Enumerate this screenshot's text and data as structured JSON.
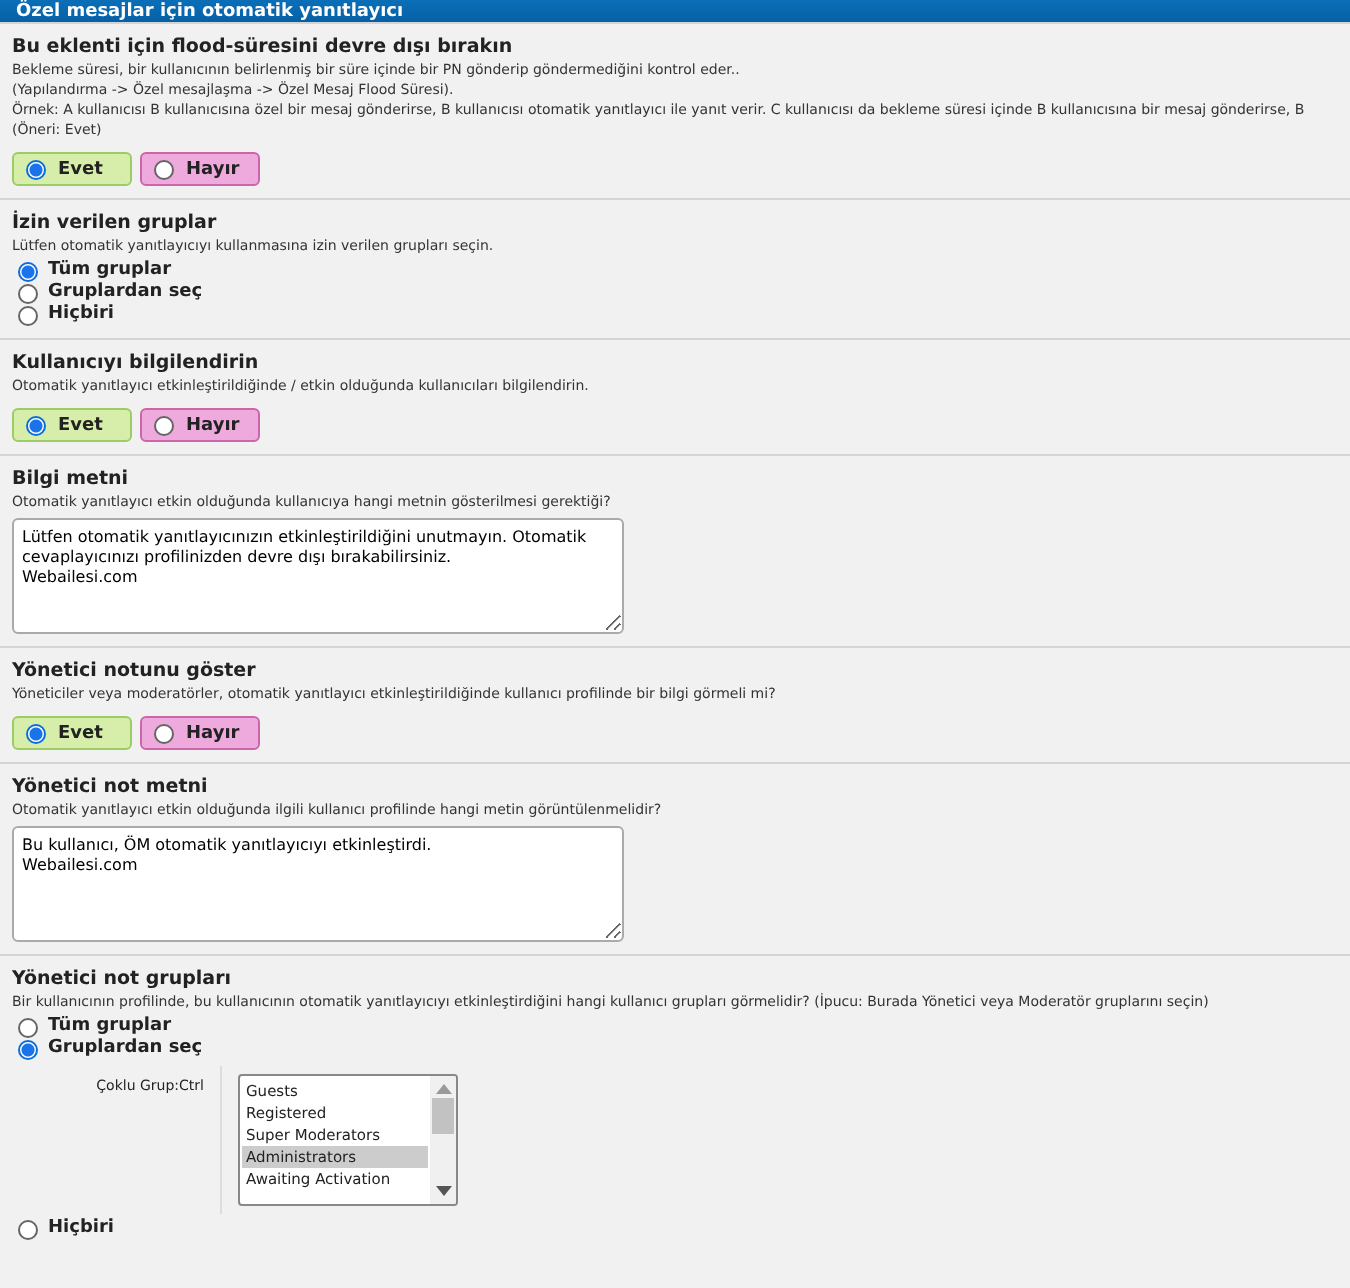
{
  "header": {
    "title": "Özel mesajlar için otomatik yanıtlayıcı"
  },
  "sections": [
    {
      "kind": "yesno",
      "title": "Bu eklenti için flood-süresini devre dışı bırakın",
      "description": [
        "Bekleme süresi, bir kullanıcının belirlenmiş bir süre içinde bir PN gönderip göndermediğini kontrol eder..",
        "(Yapılandırma -> Özel mesajlaşma -> Özel Mesaj Flood Süresi).",
        "Örnek: A kullanıcısı B kullanıcısına özel bir mesaj gönderirse, B kullanıcısı otomatik yanıtlayıcı ile yanıt verir. C kullanıcısı da bekleme süresi içinde B kullanıcısına bir mesaj gönderirse, B",
        "(Öneri: Evet)"
      ],
      "options": [
        {
          "label": "Evet",
          "selected": true
        },
        {
          "label": "Hayır",
          "selected": false
        }
      ]
    },
    {
      "kind": "radio",
      "title": "İzin verilen gruplar",
      "description": [
        "Lütfen otomatik yanıtlayıcıyı kullanmasına izin verilen grupları seçin."
      ],
      "options": [
        {
          "label": "Tüm gruplar",
          "selected": true
        },
        {
          "label": "Gruplardan seç",
          "selected": false
        },
        {
          "label": "Hiçbiri",
          "selected": false
        }
      ]
    },
    {
      "kind": "yesno",
      "title": "Kullanıcıyı bilgilendirin",
      "description": [
        "Otomatik yanıtlayıcı etkinleştirildiğinde / etkin olduğunda kullanıcıları bilgilendirin."
      ],
      "options": [
        {
          "label": "Evet",
          "selected": true
        },
        {
          "label": "Hayır",
          "selected": false
        }
      ]
    },
    {
      "kind": "textarea",
      "title": "Bilgi metni",
      "description": [
        "Otomatik yanıtlayıcı etkin olduğunda kullanıcıya hangi metnin gösterilmesi gerektiği?"
      ],
      "value": "Lütfen otomatik yanıtlayıcınızın etkinleştirildiğini unutmayın. Otomatik cevaplayıcınızı profilinizden devre dışı bırakabilirsiniz.\nWebailesi.com"
    },
    {
      "kind": "yesno",
      "title": "Yönetici notunu göster",
      "description": [
        "Yöneticiler veya moderatörler, otomatik yanıtlayıcı etkinleştirildiğinde kullanıcı profilinde bir bilgi görmeli mi?"
      ],
      "options": [
        {
          "label": "Evet",
          "selected": true
        },
        {
          "label": "Hayır",
          "selected": false
        }
      ]
    },
    {
      "kind": "textarea",
      "title": "Yönetici not metni",
      "description": [
        "Otomatik yanıtlayıcı etkin olduğunda ilgili kullanıcı profilinde hangi metin görüntülenmelidir?"
      ],
      "value": "Bu kullanıcı, ÖM otomatik yanıtlayıcıyı etkinleştirdi.\nWebailesi.com"
    },
    {
      "kind": "groups",
      "title": "Yönetici not grupları",
      "description": [
        "Bir kullanıcının profilinde, bu kullanıcının otomatik yanıtlayıcıyı etkinleştirdiğini hangi kullanıcı grupları görmelidir? (İpucu: Burada Yönetici veya Moderatör gruplarını seçin)"
      ],
      "options": [
        {
          "label": "Tüm gruplar",
          "selected": false
        },
        {
          "label": "Gruplardan seç",
          "selected": true
        },
        {
          "label": "Hiçbiri",
          "selected": false
        }
      ],
      "select_label": "Çoklu Grup:Ctrl",
      "groups": [
        {
          "label": "Guests",
          "selected": false
        },
        {
          "label": "Registered",
          "selected": false
        },
        {
          "label": "Super Moderators",
          "selected": false
        },
        {
          "label": "Administrators",
          "selected": true
        },
        {
          "label": "Awaiting Activation",
          "selected": false
        }
      ]
    }
  ]
}
